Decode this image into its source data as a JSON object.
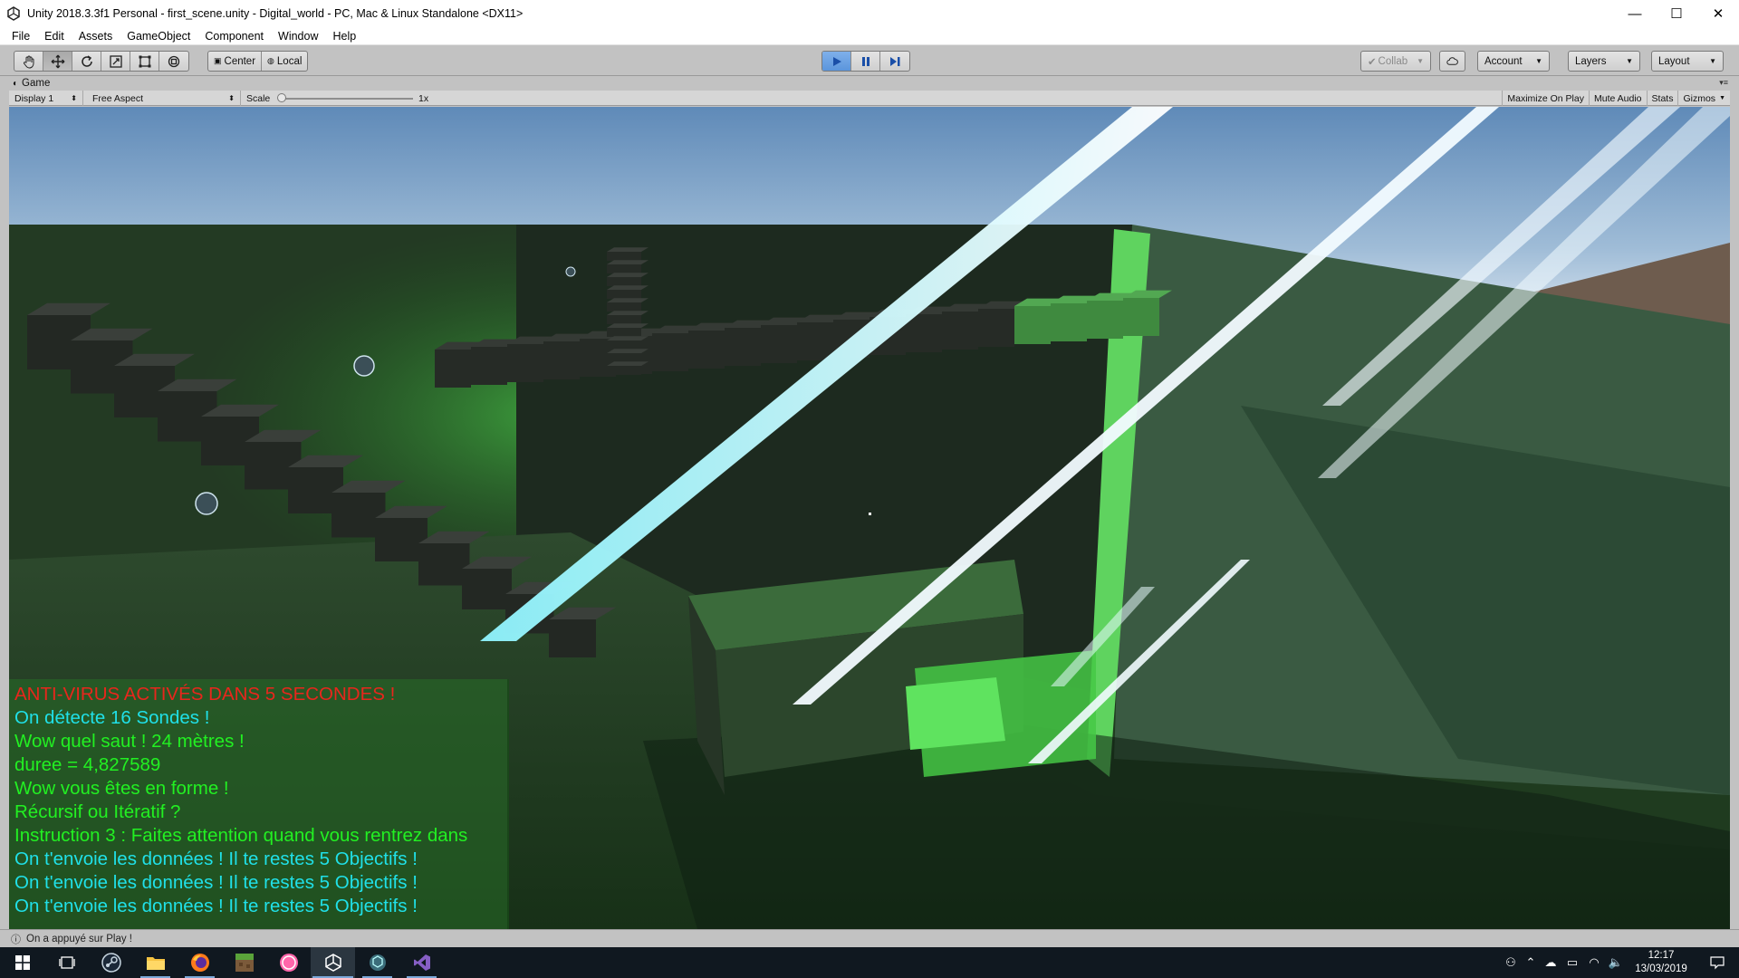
{
  "window": {
    "title": "Unity 2018.3.3f1 Personal - first_scene.unity - Digital_world - PC, Mac & Linux Standalone <DX11>",
    "controls": {
      "minimize": "—",
      "maximize": "☐",
      "close": "✕"
    }
  },
  "menu": [
    "File",
    "Edit",
    "Assets",
    "GameObject",
    "Component",
    "Window",
    "Help"
  ],
  "toolbar": {
    "tools": [
      "hand-icon",
      "move-icon",
      "rotate-icon",
      "scale-icon",
      "rect-icon",
      "transform-icon"
    ],
    "pivot": {
      "center": "Center",
      "local": "Local"
    },
    "playback": [
      "play-icon",
      "pause-icon",
      "step-icon"
    ],
    "collab": "Collab",
    "account": "Account",
    "layers": "Layers",
    "layout": "Layout"
  },
  "game_view": {
    "tab_label": "Game",
    "display": "Display 1",
    "aspect": "Free Aspect",
    "scale_label": "Scale",
    "scale_value": "1x",
    "scale_fraction": 0.0,
    "buttons": [
      "Maximize On Play",
      "Mute Audio",
      "Stats",
      "Gizmos"
    ]
  },
  "messages": [
    {
      "text": "ANTI-VIRUS ACTIVÉS DANS 5 SECONDES !",
      "color": "#e8261c"
    },
    {
      "text": "On détecte 16 Sondes !",
      "color": "#20e0e8"
    },
    {
      "text": "Wow quel saut ! 24 mètres !",
      "color": "#22f022"
    },
    {
      "text": "duree = 4,827589",
      "color": "#22f022"
    },
    {
      "text": "Wow vous êtes en forme !",
      "color": "#22f022"
    },
    {
      "text": "Récursif ou Itératif ?",
      "color": "#22f022"
    },
    {
      "text": "Instruction 3 : Faites attention quand vous rentrez dans",
      "color": "#22f022"
    },
    {
      "text": "On t'envoie les données ! Il te restes 5 Objectifs !",
      "color": "#20e0e8"
    },
    {
      "text": "On t'envoie les données ! Il te restes 5 Objectifs !",
      "color": "#20e0e8"
    },
    {
      "text": "On t'envoie les données ! Il te restes 5 Objectifs !",
      "color": "#20e0e8"
    }
  ],
  "status": {
    "text": "On a appuyé sur Play !"
  },
  "taskbar": {
    "apps": [
      "windows-start-icon",
      "task-view-icon",
      "steam-icon",
      "file-explorer-icon",
      "firefox-icon",
      "minecraft-icon",
      "osu-icon",
      "unity-icon",
      "unity-hub-icon",
      "visual-studio-icon"
    ],
    "clock_time": "12:17",
    "clock_date": "13/03/2019"
  }
}
